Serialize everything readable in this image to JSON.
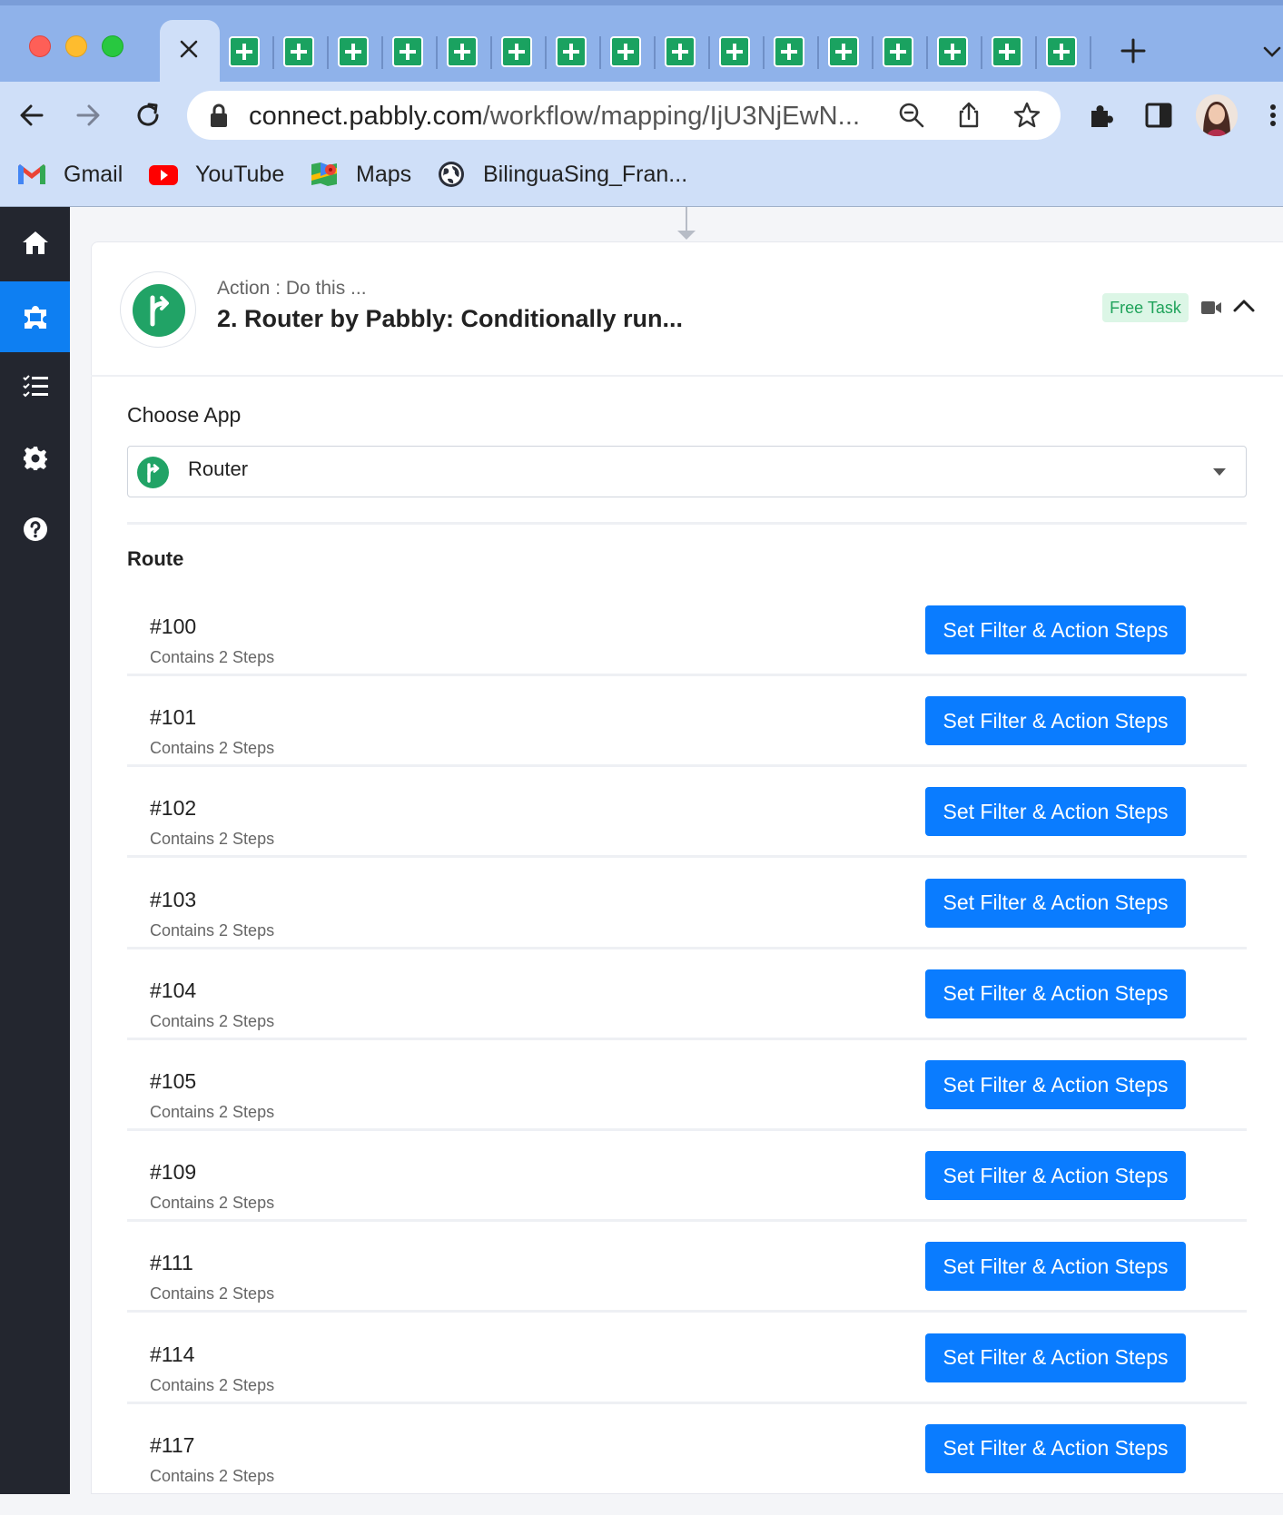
{
  "browser": {
    "url_main": "connect.pabbly.com",
    "url_path": "/workflow/mapping/IjU3NjEwN...",
    "bookmarks": [
      {
        "label": "Gmail",
        "icon": "gmail-icon"
      },
      {
        "label": "YouTube",
        "icon": "youtube-icon"
      },
      {
        "label": "Maps",
        "icon": "maps-icon"
      },
      {
        "label": "BilinguaSing_Fran...",
        "icon": "globe-icon"
      }
    ]
  },
  "sidebar": {
    "items": [
      {
        "name": "home",
        "icon": "home-icon"
      },
      {
        "name": "workflows",
        "icon": "puzzle-icon",
        "active": true
      },
      {
        "name": "task-history",
        "icon": "list-icon"
      },
      {
        "name": "settings",
        "icon": "gear-icon"
      },
      {
        "name": "help",
        "icon": "help-icon"
      }
    ]
  },
  "step": {
    "subtitle": "Action : Do this ...",
    "title": "2. Router by Pabbly: Conditionally run...",
    "badge": "Free Task"
  },
  "choose_app": {
    "label": "Choose App",
    "value": "Router"
  },
  "routes": {
    "heading": "Route",
    "button_label": "Set Filter & Action Steps",
    "items": [
      {
        "id": "#100",
        "steps": "Contains 2 Steps"
      },
      {
        "id": "#101",
        "steps": "Contains 2 Steps"
      },
      {
        "id": "#102",
        "steps": "Contains 2 Steps"
      },
      {
        "id": "#103",
        "steps": "Contains 2 Steps"
      },
      {
        "id": "#104",
        "steps": "Contains 2 Steps"
      },
      {
        "id": "#105",
        "steps": "Contains 2 Steps"
      },
      {
        "id": "#109",
        "steps": "Contains 2 Steps"
      },
      {
        "id": "#111",
        "steps": "Contains 2 Steps"
      },
      {
        "id": "#114",
        "steps": "Contains 2 Steps"
      },
      {
        "id": "#117",
        "steps": "Contains 2 Steps"
      }
    ]
  },
  "colors": {
    "accent": "#0a7cff",
    "sidebar": "#23262f",
    "router_green": "#21a366"
  }
}
